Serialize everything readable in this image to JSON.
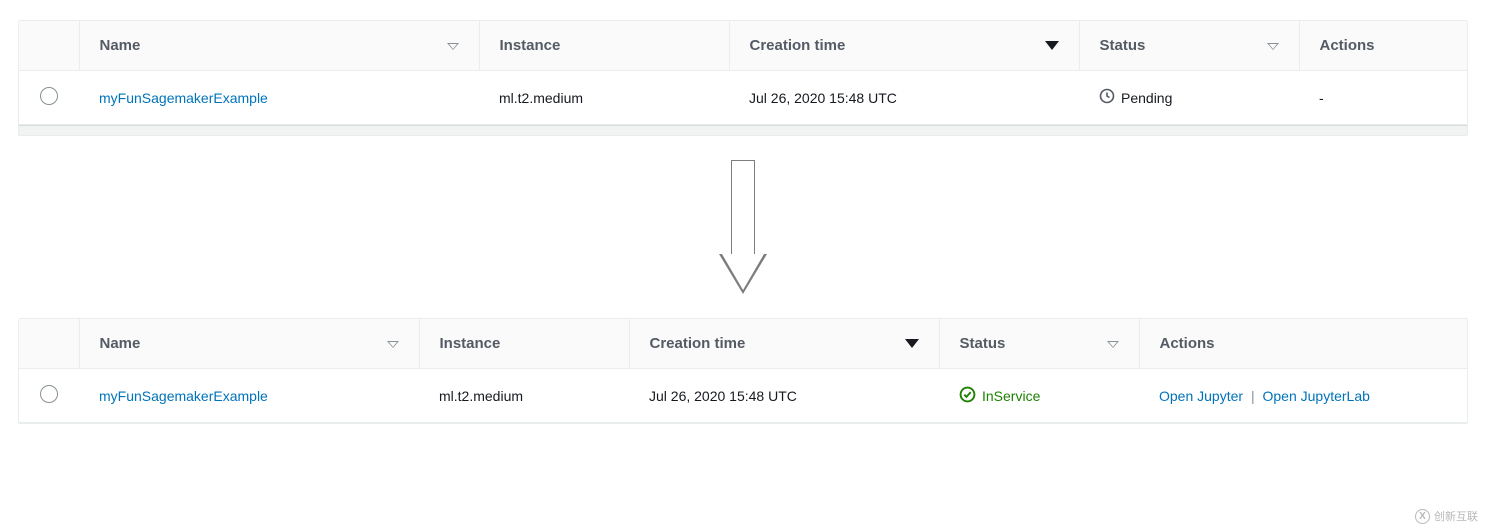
{
  "tables": {
    "before": {
      "columns": {
        "name": "Name",
        "instance": "Instance",
        "creation_time": "Creation time",
        "status": "Status",
        "actions": "Actions"
      },
      "rows": [
        {
          "name": "myFunSagemakerExample",
          "instance": "ml.t2.medium",
          "creation_time": "Jul 26, 2020 15:48 UTC",
          "status": "Pending",
          "status_icon": "clock-icon",
          "actions": "-"
        }
      ]
    },
    "after": {
      "columns": {
        "name": "Name",
        "instance": "Instance",
        "creation_time": "Creation time",
        "status": "Status",
        "actions": "Actions"
      },
      "rows": [
        {
          "name": "myFunSagemakerExample",
          "instance": "ml.t2.medium",
          "creation_time": "Jul 26, 2020 15:48 UTC",
          "status": "InService",
          "status_icon": "check-circle-icon",
          "action_links": [
            "Open Jupyter",
            "Open JupyterLab"
          ]
        }
      ]
    }
  },
  "watermark": "创新互联"
}
